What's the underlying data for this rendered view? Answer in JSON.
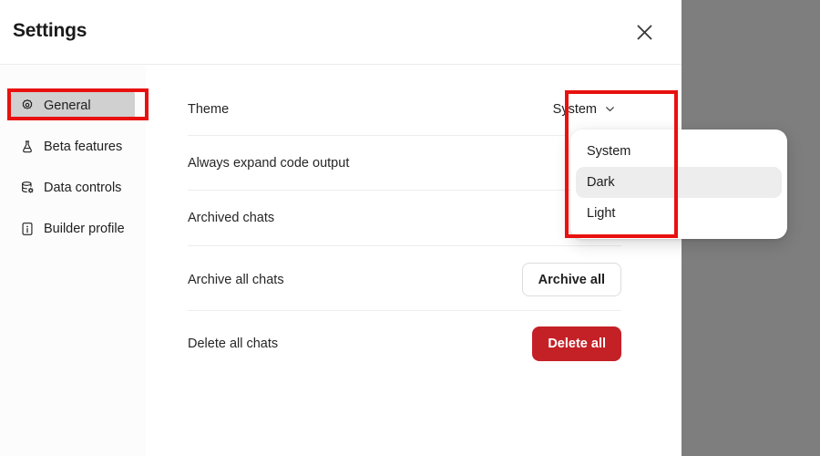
{
  "header": {
    "title": "Settings",
    "close_icon": "close-icon"
  },
  "sidebar": {
    "items": [
      {
        "label": "General",
        "icon": "gear-icon",
        "active": true
      },
      {
        "label": "Beta features",
        "icon": "flask-icon",
        "active": false
      },
      {
        "label": "Data controls",
        "icon": "database-gear-icon",
        "active": false
      },
      {
        "label": "Builder profile",
        "icon": "id-card-icon",
        "active": false
      }
    ]
  },
  "main": {
    "rows": [
      {
        "label": "Theme"
      },
      {
        "label": "Always expand code output"
      },
      {
        "label": "Archived chats"
      },
      {
        "label": "Archive all chats"
      },
      {
        "label": "Delete all chats"
      }
    ],
    "theme_select": {
      "value": "System",
      "chevron_icon": "chevron-down-icon",
      "expanded": true,
      "options": [
        {
          "label": "System",
          "highlighted": false
        },
        {
          "label": "Dark",
          "highlighted": true
        },
        {
          "label": "Light",
          "highlighted": false
        }
      ]
    },
    "archive_all_label": "Archive all",
    "delete_all_label": "Delete all"
  },
  "colors": {
    "backdrop": "#7e7e7e",
    "modal_bg": "#ffffff",
    "sidebar_bg": "#fcfcfc",
    "danger": "#c42127",
    "annotation": "#e8110f",
    "active_item_bg": "#d0d0d0",
    "highlight_bg": "#ededed",
    "divider": "#ededed"
  }
}
